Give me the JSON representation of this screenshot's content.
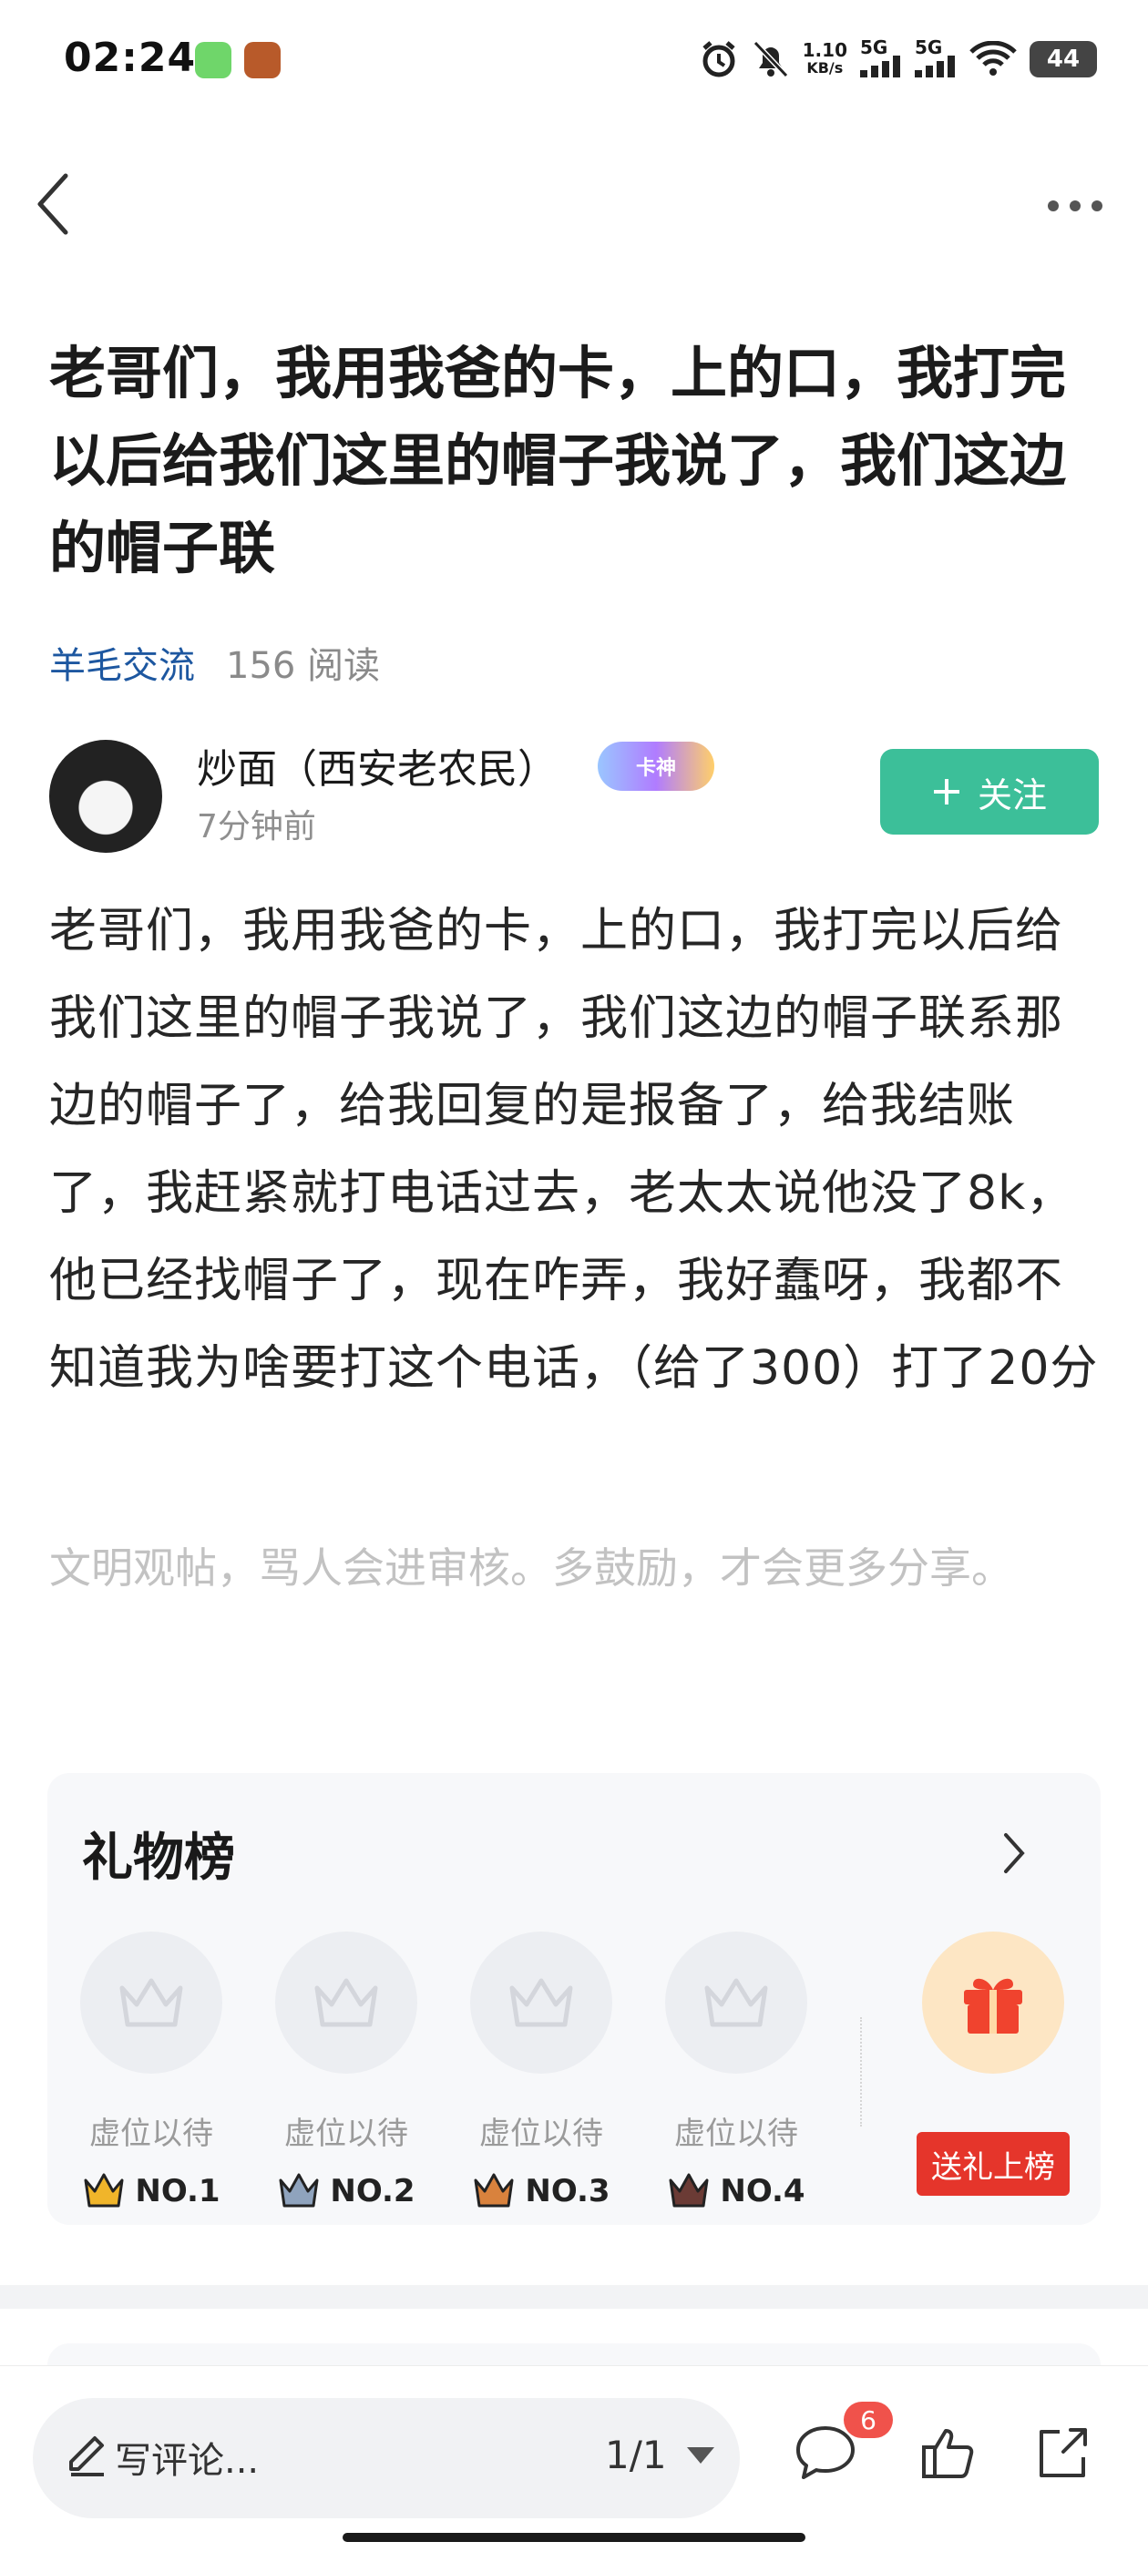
{
  "status_bar": {
    "time": "02:24",
    "net_speed_value": "1.10",
    "net_speed_unit": "KB/s",
    "signal_1": "5G",
    "signal_2": "5G",
    "battery": "44"
  },
  "post": {
    "title": "老哥们，我用我爸的卡，上的口，我打完以后给我们这里的帽子我说了，我们这边的帽子联",
    "category": "羊毛交流",
    "read_count": "156 阅读",
    "author": {
      "name": "炒面（西安老农民）",
      "badge": "卡神",
      "time": "7分钟前"
    },
    "follow_label": "关注",
    "body": "老哥们，我用我爸的卡，上的口，我打完以后给我们这里的帽子我说了，我们这边的帽子联系那边的帽子了，给我回复的是报备了，给我结账了，我赶紧就打电话过去，老太太说他没了8k，他已经找帽子了，现在咋弄，我好蠢呀，我都不知道我为啥要打这个电话，（给了300）打了20分",
    "civility_hint": "文明观帖，骂人会进审核。多鼓励，才会更多分享。"
  },
  "gift_board": {
    "title": "礼物榜",
    "slots": [
      {
        "label": "虚位以待",
        "rank": "NO.1",
        "crown_color": "#f0b52a"
      },
      {
        "label": "虚位以待",
        "rank": "NO.2",
        "crown_color": "#8fa3bd"
      },
      {
        "label": "虚位以待",
        "rank": "NO.3",
        "crown_color": "#d9823d"
      },
      {
        "label": "虚位以待",
        "rank": "NO.4",
        "crown_color": "#6b3b35"
      }
    ],
    "send_button": "送礼上榜"
  },
  "bottom_bar": {
    "comment_placeholder": "写评论...",
    "page_indicator": "1/1",
    "comment_count": "6"
  },
  "colors": {
    "accent_green": "#3cbf99",
    "category_blue": "#1d57a0",
    "gift_red": "#e5352b"
  }
}
